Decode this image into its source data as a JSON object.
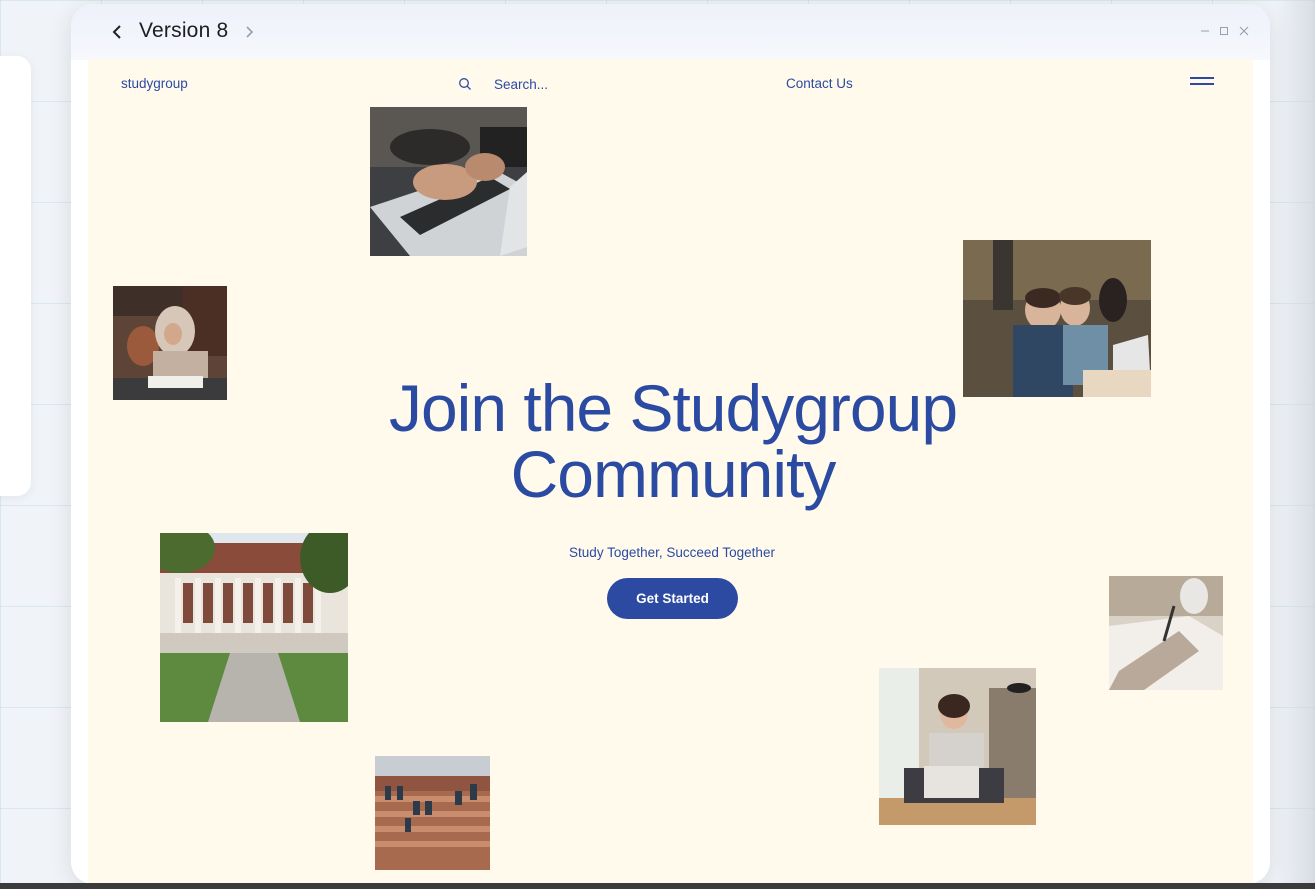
{
  "window": {
    "title": "Version 8"
  },
  "site": {
    "logo": "studygroup",
    "search": {
      "placeholder": "Search..."
    },
    "nav": {
      "contact": "Contact Us"
    },
    "hero": {
      "title_line1": "Join the Studygroup",
      "title_line2": "Community",
      "subtitle": "Study Together, Succeed Together",
      "cta": "Get Started"
    }
  },
  "colors": {
    "brand_blue": "#2b4ba3",
    "page_bg": "#fffaec",
    "button_bg": "#2c4aa2"
  },
  "icons": {
    "back": "chevron-left-icon",
    "forward": "chevron-right-icon",
    "search": "search-icon",
    "menu": "hamburger-menu-icon",
    "minimize": "minimize-icon",
    "maximize": "maximize-icon",
    "close": "close-icon"
  },
  "photos": [
    {
      "subject": "hands typing on laptop"
    },
    {
      "subject": "student in hijab studying in library"
    },
    {
      "subject": "two students studying at laptop in cafe"
    },
    {
      "subject": "university library building with lawn and people"
    },
    {
      "subject": "hand writing with pen beside coffee cup"
    },
    {
      "subject": "woman sitting cross-legged with laptop"
    },
    {
      "subject": "students sitting on brick amphitheater steps"
    }
  ]
}
